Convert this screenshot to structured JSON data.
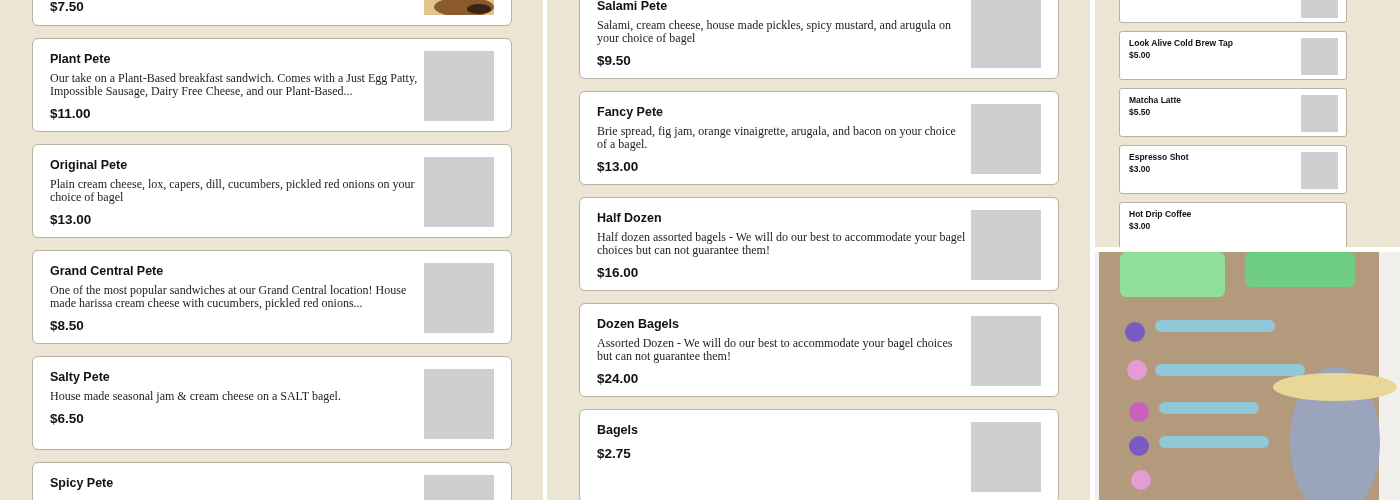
{
  "panels": [
    {
      "kind": "food",
      "cards": [
        {
          "price": "$7.50"
        },
        {
          "title": "Plant Pete",
          "description": "Our take on a Plant-Based breakfast sandwich. Comes with a Just Egg Patty, Impossible Sausage, Dairy Free Cheese, and our Plant-Based...",
          "price": "$11.00",
          "kind": "placeholder"
        },
        {
          "title": "Original Pete",
          "description": "Plain cream cheese, lox, capers, dill, cucumbers, pickled red onions on your choice of bagel",
          "price": "$13.00",
          "kind": "placeholder"
        },
        {
          "title": "Grand Central Pete",
          "description": "One of the most popular sandwiches at our Grand Central location! House made harissa cream cheese with cucumbers, pickled red onions...",
          "price": "$8.50",
          "kind": "placeholder"
        },
        {
          "title": "Salty Pete",
          "description": "House made seasonal jam & cream cheese on a SALT bagel.",
          "price": "$6.50",
          "kind": "placeholder"
        },
        {
          "title": "Spicy Pete",
          "kind": "placeholder"
        }
      ]
    },
    {
      "kind": "food",
      "cards": [
        {
          "title": "Salami Pete",
          "description": "Salami, cream cheese, house made pickles, spicy mustard, and arugula on your choice of bagel",
          "price": "$9.50",
          "kind": "placeholder"
        },
        {
          "title": "Fancy Pete",
          "description": "Brie spread, fig jam, orange vinaigrette, arugala, and bacon on your choice of a bagel.",
          "price": "$13.00",
          "kind": "placeholder"
        },
        {
          "title": "Half Dozen",
          "description": "Half dozen assorted bagels - We will do our best to accommodate your bagel choices but can not guarantee them!",
          "price": "$16.00",
          "kind": "placeholder"
        },
        {
          "title": "Dozen Bagels",
          "description": "Assorted Dozen - We will do our best to accommodate your bagel choices but can not guarantee them!",
          "price": "$24.00",
          "kind": "placeholder"
        },
        {
          "title": "Bagels",
          "price": "$2.75",
          "kind": "placeholder"
        }
      ]
    },
    {
      "kind": "drinks",
      "cards": [
        {
          "kind": "placeholder"
        },
        {
          "title": "Look Alive Cold Brew Tap",
          "price": "$5.00",
          "kind": "placeholder"
        },
        {
          "title": "Matcha Latte",
          "price": "$5.50",
          "kind": "placeholder"
        },
        {
          "title": "Espresso Shot",
          "price": "$3.00",
          "kind": "placeholder"
        },
        {
          "title": "Hot Drip Coffee",
          "price": "$3.00",
          "kind": "plain"
        }
      ]
    }
  ]
}
